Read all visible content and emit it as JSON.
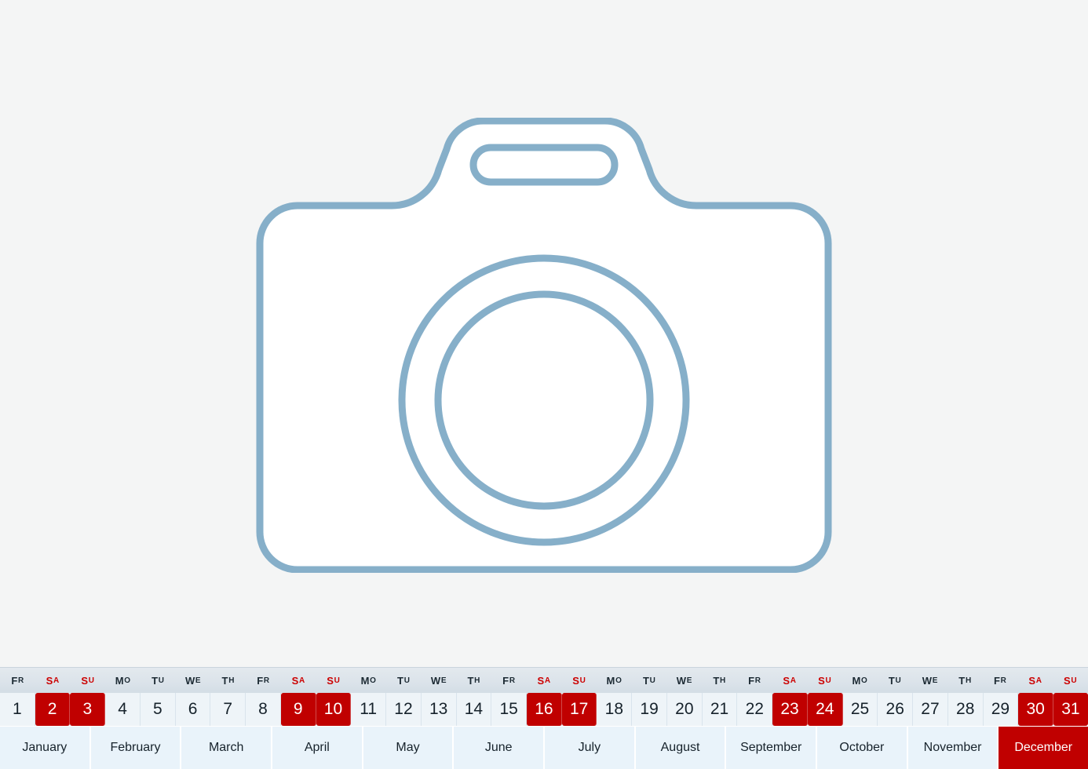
{
  "colors": {
    "background": "#f4f5f5",
    "icon_stroke": "#86afc9",
    "icon_fill": "#ffffff",
    "accent_red": "#c00000",
    "weekend_text": "#cc0000",
    "day_row_bg": "#eef4f8",
    "month_row_bg": "#e9f3fa",
    "weekday_row_bg": "#dbe3ea"
  },
  "placeholder": {
    "icon": "camera-icon",
    "description": "camera placeholder image"
  },
  "calendar": {
    "weekdays": [
      {
        "big": "F",
        "small": "R",
        "weekend": false
      },
      {
        "big": "S",
        "small": "A",
        "weekend": true
      },
      {
        "big": "S",
        "small": "U",
        "weekend": true
      },
      {
        "big": "M",
        "small": "O",
        "weekend": false
      },
      {
        "big": "T",
        "small": "U",
        "weekend": false
      },
      {
        "big": "W",
        "small": "E",
        "weekend": false
      },
      {
        "big": "T",
        "small": "H",
        "weekend": false
      },
      {
        "big": "F",
        "small": "R",
        "weekend": false
      },
      {
        "big": "S",
        "small": "A",
        "weekend": true
      },
      {
        "big": "S",
        "small": "U",
        "weekend": true
      },
      {
        "big": "M",
        "small": "O",
        "weekend": false
      },
      {
        "big": "T",
        "small": "U",
        "weekend": false
      },
      {
        "big": "W",
        "small": "E",
        "weekend": false
      },
      {
        "big": "T",
        "small": "H",
        "weekend": false
      },
      {
        "big": "F",
        "small": "R",
        "weekend": false
      },
      {
        "big": "S",
        "small": "A",
        "weekend": true
      },
      {
        "big": "S",
        "small": "U",
        "weekend": true
      },
      {
        "big": "M",
        "small": "O",
        "weekend": false
      },
      {
        "big": "T",
        "small": "U",
        "weekend": false
      },
      {
        "big": "W",
        "small": "E",
        "weekend": false
      },
      {
        "big": "T",
        "small": "H",
        "weekend": false
      },
      {
        "big": "F",
        "small": "R",
        "weekend": false
      },
      {
        "big": "S",
        "small": "A",
        "weekend": true
      },
      {
        "big": "S",
        "small": "U",
        "weekend": true
      },
      {
        "big": "M",
        "small": "O",
        "weekend": false
      },
      {
        "big": "T",
        "small": "U",
        "weekend": false
      },
      {
        "big": "W",
        "small": "E",
        "weekend": false
      },
      {
        "big": "T",
        "small": "H",
        "weekend": false
      },
      {
        "big": "F",
        "small": "R",
        "weekend": false
      },
      {
        "big": "S",
        "small": "A",
        "weekend": true
      },
      {
        "big": "S",
        "small": "U",
        "weekend": true
      }
    ],
    "days": [
      {
        "label": "1",
        "weekend": false
      },
      {
        "label": "2",
        "weekend": true
      },
      {
        "label": "3",
        "weekend": true
      },
      {
        "label": "4",
        "weekend": false
      },
      {
        "label": "5",
        "weekend": false
      },
      {
        "label": "6",
        "weekend": false
      },
      {
        "label": "7",
        "weekend": false
      },
      {
        "label": "8",
        "weekend": false
      },
      {
        "label": "9",
        "weekend": true
      },
      {
        "label": "10",
        "weekend": true
      },
      {
        "label": "11",
        "weekend": false
      },
      {
        "label": "12",
        "weekend": false
      },
      {
        "label": "13",
        "weekend": false
      },
      {
        "label": "14",
        "weekend": false
      },
      {
        "label": "15",
        "weekend": false
      },
      {
        "label": "16",
        "weekend": true
      },
      {
        "label": "17",
        "weekend": true
      },
      {
        "label": "18",
        "weekend": false
      },
      {
        "label": "19",
        "weekend": false
      },
      {
        "label": "20",
        "weekend": false
      },
      {
        "label": "21",
        "weekend": false
      },
      {
        "label": "22",
        "weekend": false
      },
      {
        "label": "23",
        "weekend": true
      },
      {
        "label": "24",
        "weekend": true
      },
      {
        "label": "25",
        "weekend": false
      },
      {
        "label": "26",
        "weekend": false
      },
      {
        "label": "27",
        "weekend": false
      },
      {
        "label": "28",
        "weekend": false
      },
      {
        "label": "29",
        "weekend": false
      },
      {
        "label": "30",
        "weekend": true
      },
      {
        "label": "31",
        "weekend": true
      }
    ],
    "months": [
      {
        "label": "January",
        "active": false
      },
      {
        "label": "February",
        "active": false
      },
      {
        "label": "March",
        "active": false
      },
      {
        "label": "April",
        "active": false
      },
      {
        "label": "May",
        "active": false
      },
      {
        "label": "June",
        "active": false
      },
      {
        "label": "July",
        "active": false
      },
      {
        "label": "August",
        "active": false
      },
      {
        "label": "September",
        "active": false
      },
      {
        "label": "October",
        "active": false
      },
      {
        "label": "November",
        "active": false
      },
      {
        "label": "December",
        "active": true
      }
    ]
  }
}
